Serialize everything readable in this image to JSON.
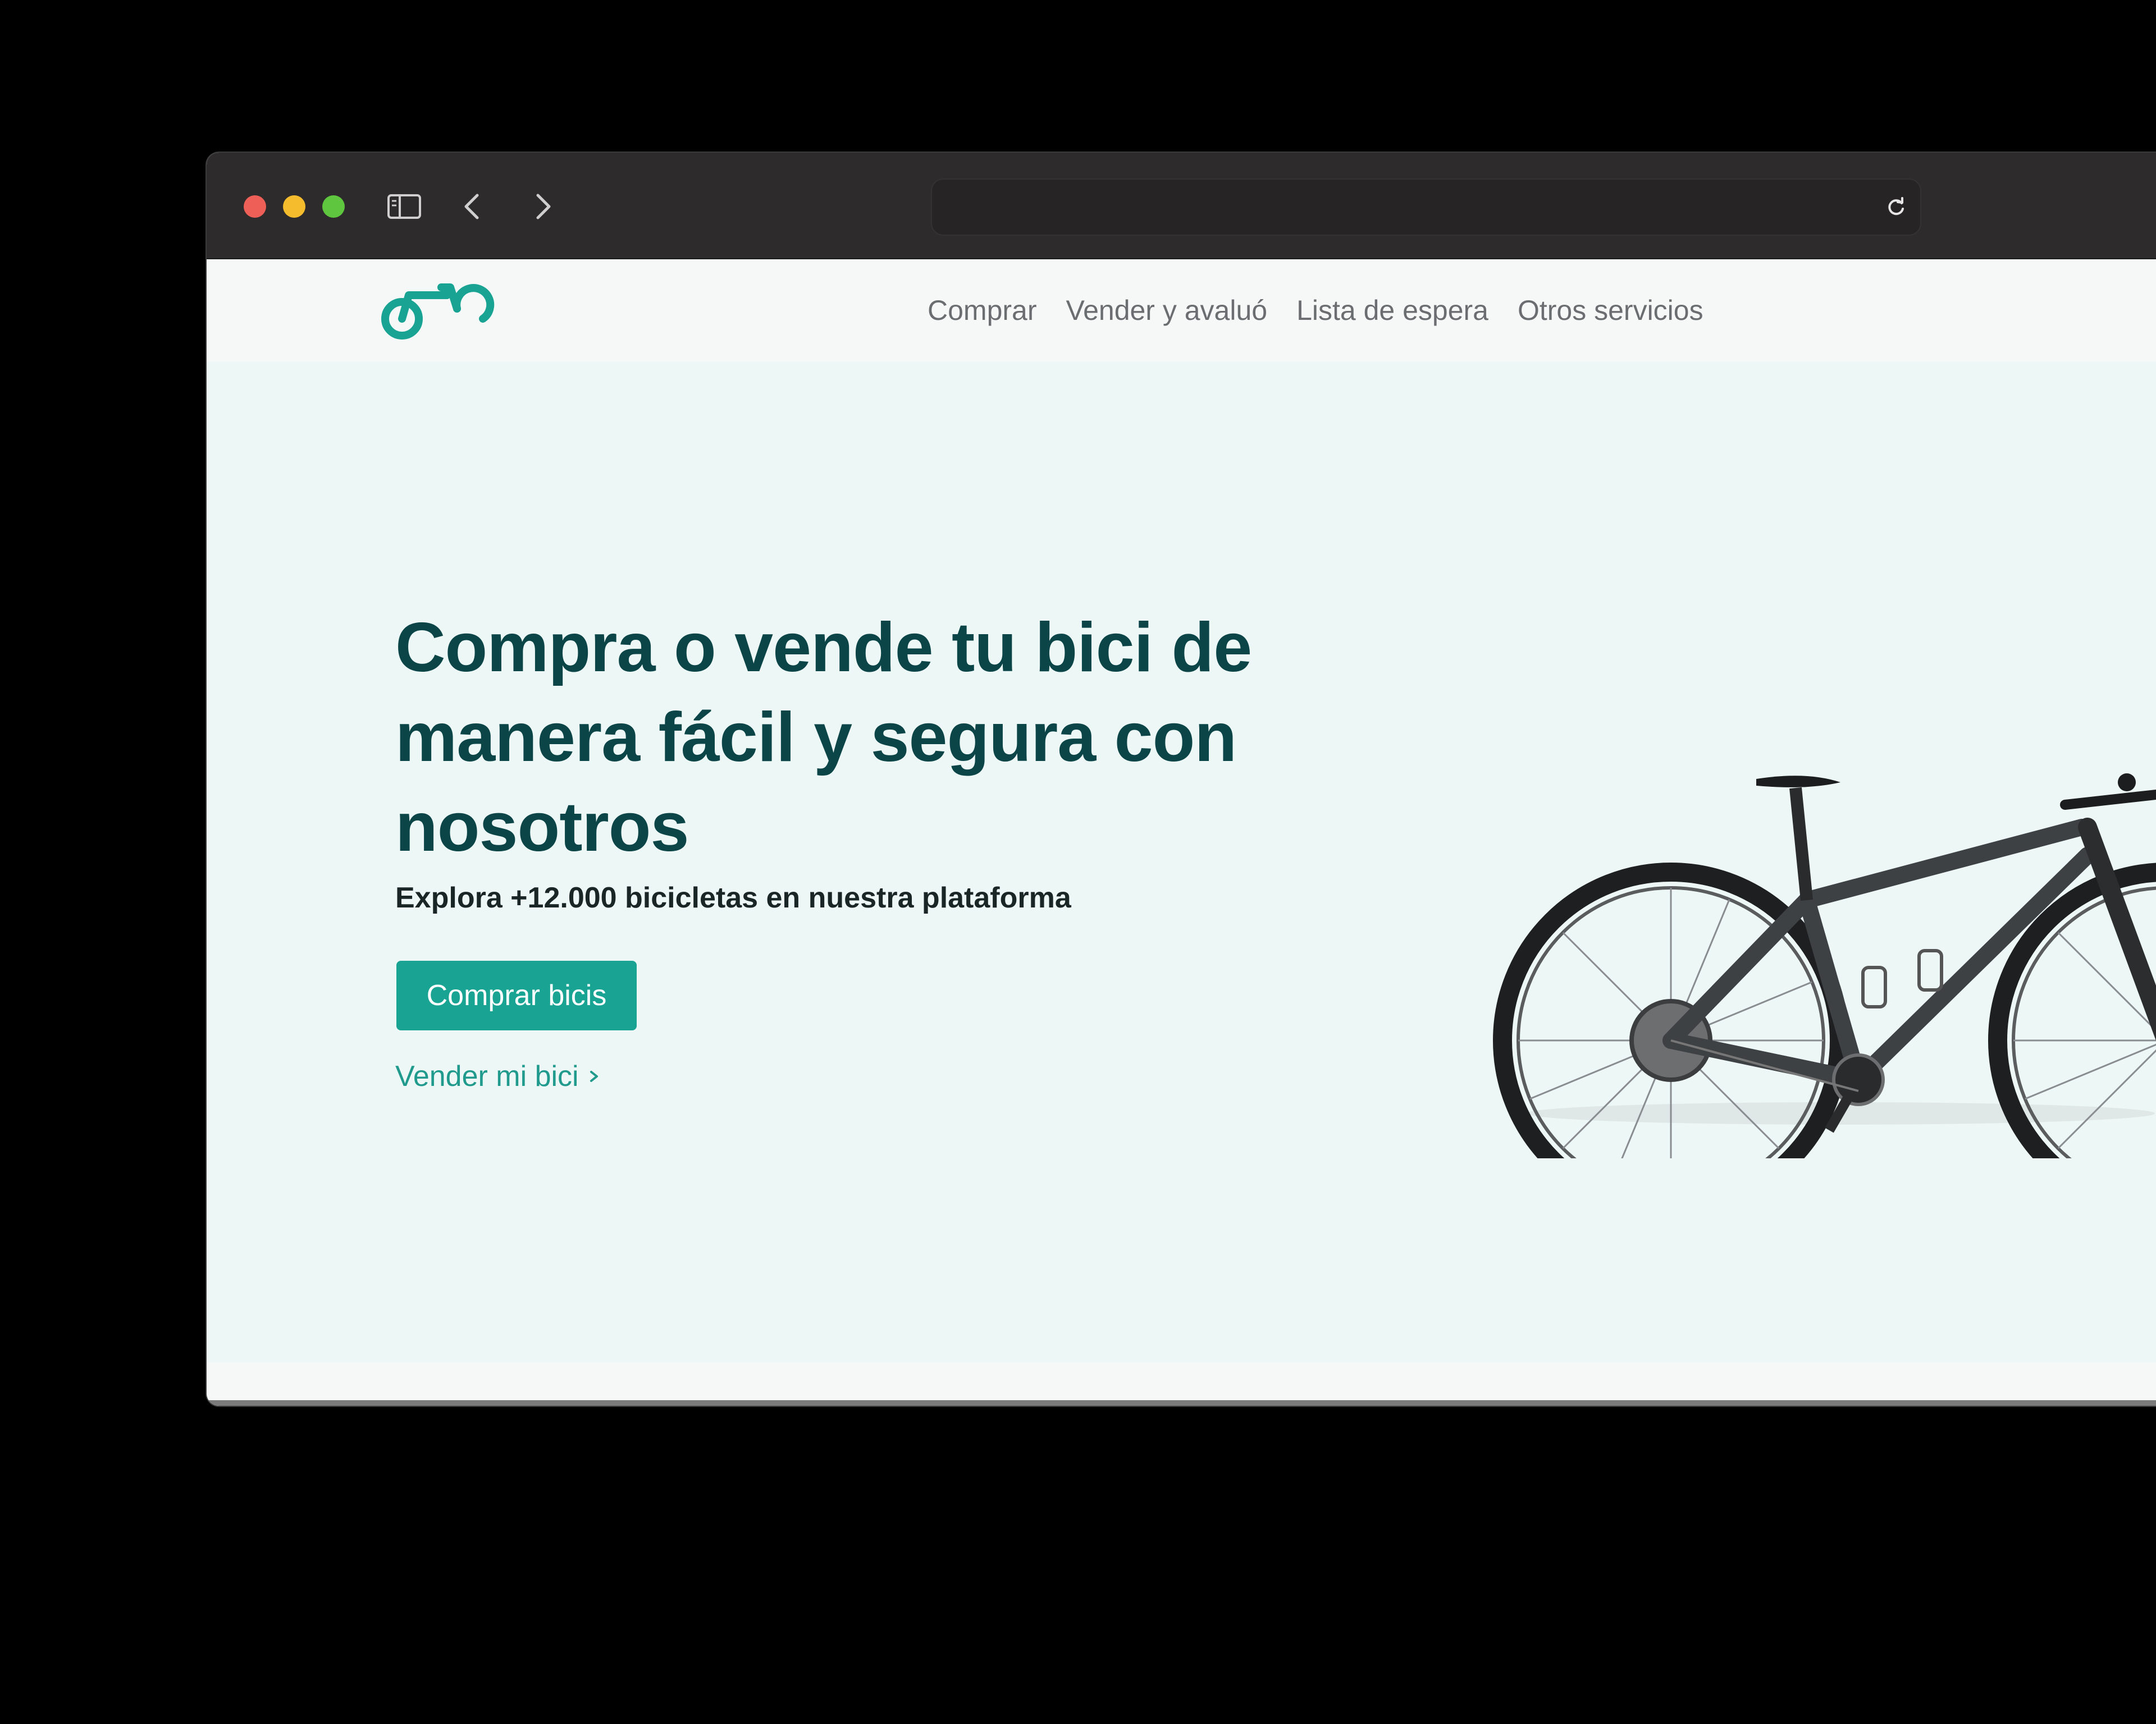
{
  "browser": {
    "icons": {
      "traffic_lights": [
        "close",
        "minimize",
        "maximize"
      ],
      "toolbar": [
        "sidebar-icon",
        "back-chevron-icon",
        "forward-chevron-icon",
        "reload-icon"
      ]
    }
  },
  "nav": {
    "logo_icon": "bike-logo-icon",
    "links": [
      {
        "label": "Comprar"
      },
      {
        "label": "Vender y avaluó"
      },
      {
        "label": "Lista de espera"
      },
      {
        "label": "Otros servicios"
      }
    ]
  },
  "hero": {
    "headline": "Compra o vende tu bici de manera fácil y segura con nosotros",
    "subtitle": "Explora +12.000 bicicletas en nuestra plataforma",
    "primary_button": "Comprar bicis",
    "secondary_link": "Vender mi bici"
  },
  "colors": {
    "brand": "#19a393",
    "headline": "#0b4547",
    "hero_background": "#ecf7f6"
  }
}
